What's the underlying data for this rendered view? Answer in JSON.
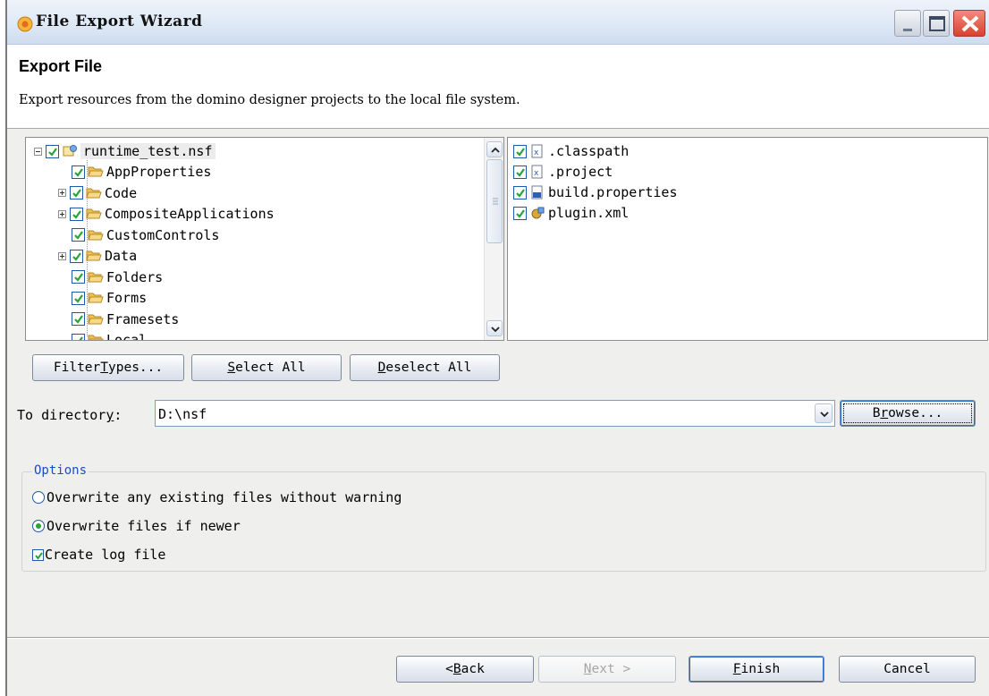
{
  "window": {
    "title": "File Export Wizard"
  },
  "header": {
    "title": "Export File",
    "description": "Export resources from the domino designer projects to the local file system."
  },
  "tree": {
    "root": {
      "label": "runtime_test.nsf",
      "checked": true,
      "expanded": true
    },
    "items": [
      {
        "label": "AppProperties",
        "checked": true,
        "expandable": false
      },
      {
        "label": "Code",
        "checked": true,
        "expandable": true
      },
      {
        "label": "CompositeApplications",
        "checked": true,
        "expandable": true
      },
      {
        "label": "CustomControls",
        "checked": true,
        "expandable": false
      },
      {
        "label": "Data",
        "checked": true,
        "expandable": true
      },
      {
        "label": "Folders",
        "checked": true,
        "expandable": false
      },
      {
        "label": "Forms",
        "checked": true,
        "expandable": false
      },
      {
        "label": "Framesets",
        "checked": true,
        "expandable": false
      },
      {
        "label": "Local",
        "checked": true,
        "expandable": false
      }
    ]
  },
  "files": {
    "items": [
      {
        "label": ".classpath",
        "checked": true,
        "icon": "xml-file-icon"
      },
      {
        "label": ".project",
        "checked": true,
        "icon": "xml-file-icon"
      },
      {
        "label": "build.properties",
        "checked": true,
        "icon": "properties-file-icon"
      },
      {
        "label": "plugin.xml",
        "checked": true,
        "icon": "plugin-file-icon"
      }
    ]
  },
  "buttons": {
    "filter_types": {
      "pre": "Filter ",
      "key": "T",
      "post": "ypes..."
    },
    "select_all": {
      "pre": "",
      "key": "S",
      "post": "elect All"
    },
    "deselect_all": {
      "pre": "",
      "key": "D",
      "post": "eselect All"
    },
    "browse": {
      "pre": "B",
      "key": "r",
      "post": "owse..."
    },
    "back": {
      "pre": "< ",
      "key": "B",
      "post": "ack"
    },
    "next": {
      "pre": "",
      "key": "N",
      "post": "ext >"
    },
    "finish": {
      "pre": "",
      "key": "F",
      "post": "inish"
    },
    "cancel": {
      "label": "Cancel"
    }
  },
  "directory": {
    "label_pre": "To director",
    "label_key": "y",
    "label_post": ":",
    "value": "D:\\nsf"
  },
  "options": {
    "legend": "Options",
    "overwrite_without_warning": {
      "label": "Overwrite any existing files without warning",
      "selected": false
    },
    "overwrite_if_newer": {
      "label": "Overwrite files if newer",
      "selected": true
    },
    "create_log": {
      "label": "Create log file",
      "checked": true
    }
  },
  "colors": {
    "check_green": "#2aa33a",
    "folder_yellow": "#f2c14e",
    "legend_blue": "#1c4dbd"
  }
}
